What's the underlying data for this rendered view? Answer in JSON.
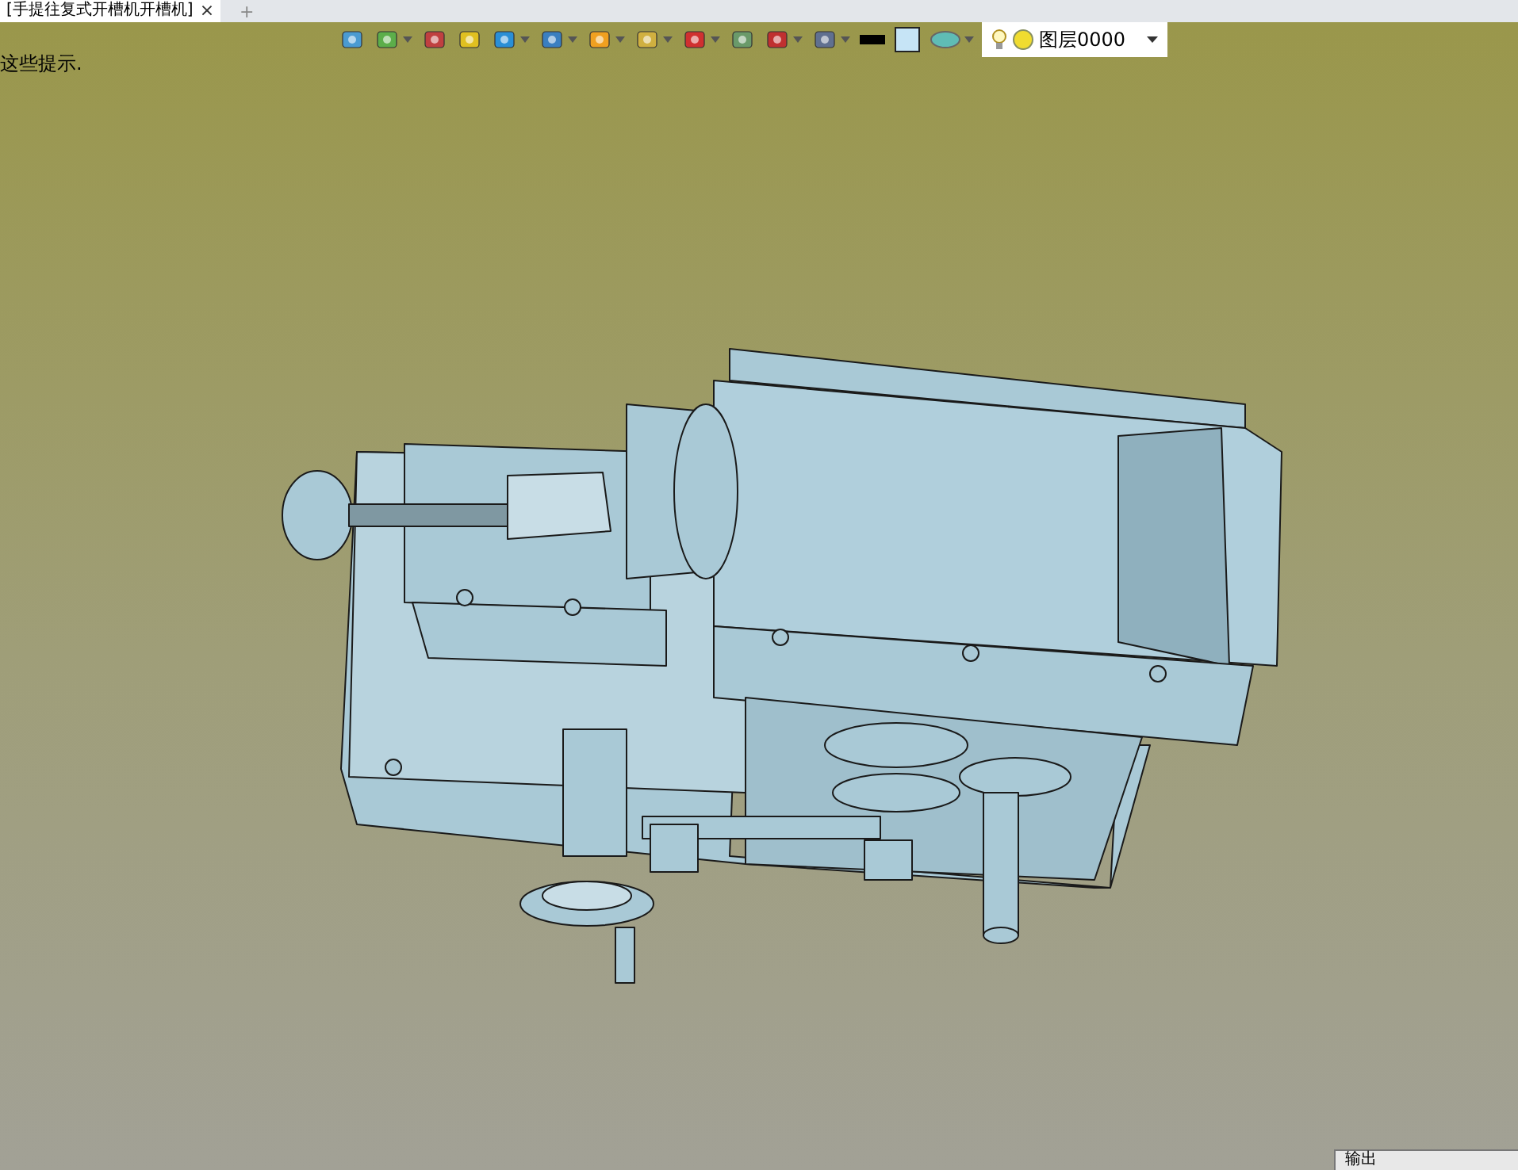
{
  "tab": {
    "title": "[手提往复式开槽机开槽机]",
    "close": "×",
    "add": "+"
  },
  "hint": "这些提示.",
  "layer": {
    "name": "图层0000"
  },
  "output_panel": {
    "title": "输出"
  }
}
